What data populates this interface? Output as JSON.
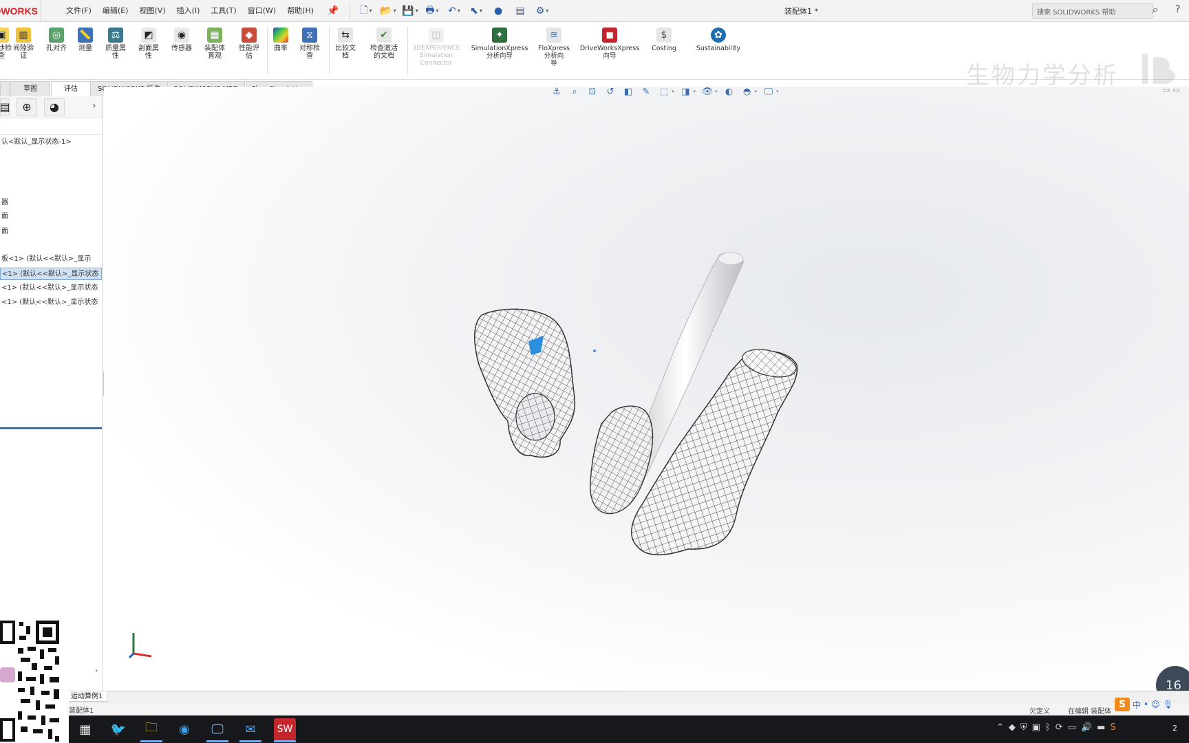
{
  "app": {
    "brand": "DWORKS",
    "menus": [
      "文件(F)",
      "编辑(E)",
      "视图(V)",
      "插入(I)",
      "工具(T)",
      "窗口(W)",
      "帮助(H)"
    ],
    "document_title": "装配体1 *",
    "search_placeholder": "搜索 SOLIDWORKS 帮助"
  },
  "ribbon": {
    "buttons": [
      {
        "label": "干涉检\n查",
        "icon": "interference-icon",
        "state": "enabled"
      },
      {
        "label": "间隙验\n证",
        "icon": "clearance-icon",
        "state": "enabled"
      },
      {
        "label": "孔对齐",
        "icon": "hole-align-icon",
        "state": "enabled"
      },
      {
        "label": "测量",
        "icon": "measure-icon",
        "state": "enabled"
      },
      {
        "label": "质量属\n性",
        "icon": "mass-properties-icon",
        "state": "enabled"
      },
      {
        "label": "剖面属\n性",
        "icon": "section-properties-icon",
        "state": "enabled"
      },
      {
        "label": "传感器",
        "icon": "sensor-icon",
        "state": "enabled"
      },
      {
        "label": "装配体\n直观",
        "icon": "assembly-visualization-icon",
        "state": "enabled"
      },
      {
        "label": "性能评\n估",
        "icon": "performance-icon",
        "state": "enabled"
      },
      {
        "label": "曲率",
        "icon": "curvature-icon",
        "state": "enabled"
      },
      {
        "label": "对称检\n查",
        "icon": "symmetry-check-icon",
        "state": "enabled"
      },
      {
        "label": "比较文\n档",
        "icon": "compare-icon",
        "state": "enabled"
      },
      {
        "label": "检查激活\n的文档",
        "icon": "check-document-icon",
        "state": "enabled"
      },
      {
        "label": "3DEXPERIENCE\nSimulation\nConnector",
        "icon": "3dx-icon",
        "state": "disabled"
      },
      {
        "label": "SimulationXpress\n分析向导",
        "icon": "simulationxpress-icon",
        "state": "enabled"
      },
      {
        "label": "FloXpress\n分析向\n导",
        "icon": "floxpress-icon",
        "state": "enabled"
      },
      {
        "label": "DriveWorksXpress\n向导",
        "icon": "driveworks-icon",
        "state": "enabled"
      },
      {
        "label": "Costing",
        "icon": "costing-icon",
        "state": "enabled"
      },
      {
        "label": "Sustainability",
        "icon": "sustainability-icon",
        "state": "enabled"
      }
    ],
    "watermark": "生物力学分析"
  },
  "tabs": [
    {
      "label": "",
      "active": false
    },
    {
      "label": "草图",
      "active": false
    },
    {
      "label": "评估",
      "active": true
    },
    {
      "label": "SOLIDWORKS 插件",
      "active": false
    },
    {
      "label": "SOLIDWORKS MBD",
      "active": false
    },
    {
      "label": "Flow Simulation",
      "active": false
    }
  ],
  "tree": {
    "items": [
      {
        "label": "认<默认_显示状态-1>",
        "selected": false
      },
      {
        "label": "器",
        "selected": false
      },
      {
        "label": "面",
        "selected": false
      },
      {
        "label": "面",
        "selected": false
      },
      {
        "label": "板<1> (默认<<默认>_显示",
        "selected": false
      },
      {
        "label": "<1> (默认<<默认>_显示状态",
        "selected": true
      },
      {
        "label": "<1> (默认<<默认>_显示状态",
        "selected": false
      },
      {
        "label": "<1> (默认<<默认>_显示状态",
        "selected": false
      }
    ]
  },
  "bottom": {
    "sheet_tab": "运动算例1",
    "status_left": "装配体1",
    "status_r1": "欠定义",
    "status_r2": "在编辑 装配体",
    "timer": "16"
  },
  "colors": {
    "brand_red": "#d6262b",
    "selection_blue": "#cfe2f5",
    "accent_blue": "#3a6fb0",
    "taskbar": "#16181b"
  }
}
